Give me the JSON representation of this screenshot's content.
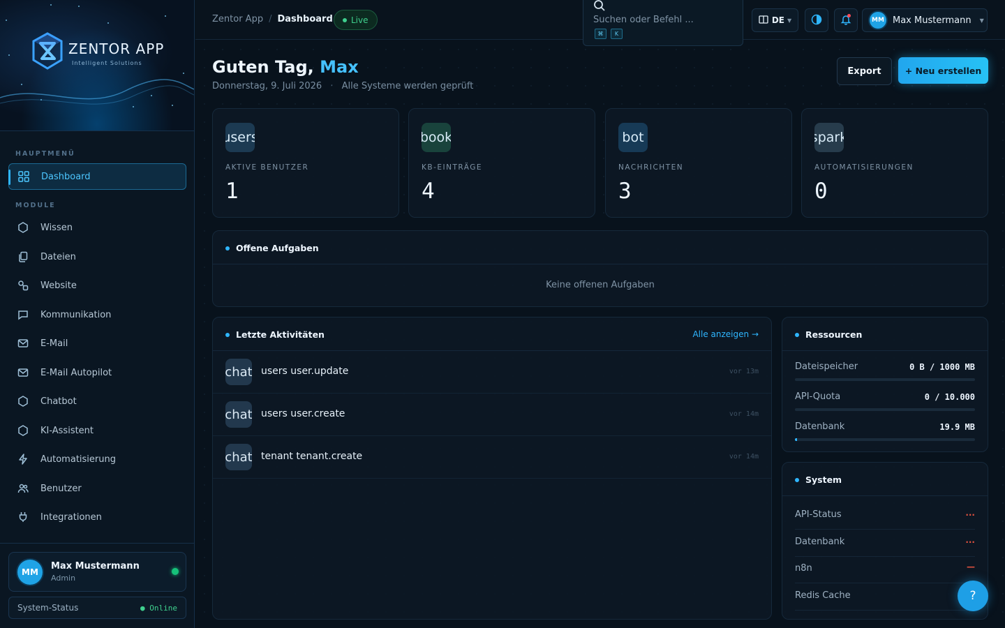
{
  "brand": {
    "title": "ZENTOR APP",
    "subtitle": "Intelligent Solutions"
  },
  "sidebar": {
    "section_main": "HAUPTMENÜ",
    "section_modules": "MODULE",
    "active_item": "Dashboard",
    "items": [
      {
        "label": "Wissen",
        "icon": "hexagon-icon"
      },
      {
        "label": "Dateien",
        "icon": "files-icon"
      },
      {
        "label": "Website",
        "icon": "link-icon"
      },
      {
        "label": "Kommunikation",
        "icon": "chat-icon"
      },
      {
        "label": "E-Mail",
        "icon": "mail-icon"
      },
      {
        "label": "E-Mail Autopilot",
        "icon": "mail-icon"
      },
      {
        "label": "Chatbot",
        "icon": "hexagon-icon"
      },
      {
        "label": "KI-Assistent",
        "icon": "hexagon-icon"
      },
      {
        "label": "Automatisierung",
        "icon": "lightning-icon"
      },
      {
        "label": "Benutzer",
        "icon": "users-icon"
      },
      {
        "label": "Integrationen",
        "icon": "plug-icon"
      }
    ],
    "user": {
      "initials": "MM",
      "name": "Max Mustermann",
      "role": "Admin"
    },
    "system_status": {
      "label": "System-Status",
      "value": "● Online"
    }
  },
  "topbar": {
    "breadcrumb": [
      "Zentor App",
      "Dashboard"
    ],
    "live_label": "Live",
    "search_placeholder": "Suchen oder Befehl ...",
    "shortcut": [
      "⌘",
      "K"
    ],
    "language": "DE",
    "user": {
      "initials": "MM",
      "name": "Max Mustermann"
    }
  },
  "header": {
    "greeting": "Guten Tag, ",
    "name": "Max",
    "date": "Donnerstag, 9. Juli 2026",
    "status": "Alle Systeme werden geprüft",
    "export_label": "Export",
    "new_label": "+ Neu erstellen"
  },
  "stats": [
    {
      "icon_text": "users",
      "label": "AKTIVE BENUTZER",
      "value": "1"
    },
    {
      "icon_text": "book",
      "label": "KB-EINTRÄGE",
      "value": "4"
    },
    {
      "icon_text": "bot",
      "label": "NACHRICHTEN",
      "value": "3"
    },
    {
      "icon_text": "spark",
      "label": "AUTOMATISIERUNGEN",
      "value": "0"
    }
  ],
  "tasks": {
    "title": "Offene Aufgaben",
    "empty": "Keine offenen Aufgaben"
  },
  "activities": {
    "title": "Letzte Aktivitäten",
    "link": "Alle anzeigen →",
    "rows": [
      {
        "icon_text": "chat",
        "text": "users user.update",
        "time": "vor 13m"
      },
      {
        "icon_text": "chat",
        "text": "users user.create",
        "time": "vor 14m"
      },
      {
        "icon_text": "chat",
        "text": "tenant tenant.create",
        "time": "vor 14m"
      }
    ]
  },
  "resources": {
    "title": "Ressourcen",
    "rows": [
      {
        "label": "Dateispeicher",
        "value": "0 B / 1000 MB",
        "fill": 0
      },
      {
        "label": "API-Quota",
        "value": "0 / 10.000",
        "fill": 0
      },
      {
        "label": "Datenbank",
        "value": "19.9 MB",
        "fill": 0.01
      }
    ]
  },
  "system": {
    "title": "System",
    "rows": [
      {
        "label": "API-Status",
        "value": "..."
      },
      {
        "label": "Datenbank",
        "value": "..."
      },
      {
        "label": "n8n",
        "value": "—"
      },
      {
        "label": "Redis Cache",
        "value": ""
      }
    ]
  },
  "help_label": "?",
  "colors": {
    "accent": "#2fb6ff",
    "online": "#3fd08e",
    "error": "#e0513f",
    "background": "#08121c"
  }
}
